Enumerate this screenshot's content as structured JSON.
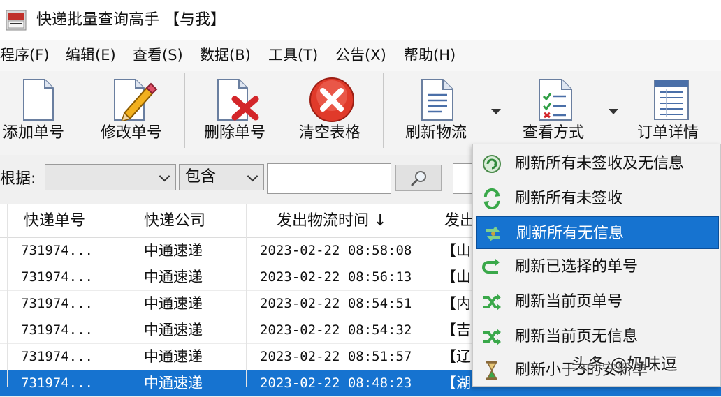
{
  "window": {
    "title": "快递批量查询高手  【与我】"
  },
  "menu": [
    "程序(F)",
    "编辑(E)",
    "查看(S)",
    "数据(B)",
    "工具(T)",
    "公告(X)",
    "帮助(H)"
  ],
  "toolbar": {
    "add": "添加单号",
    "edit": "修改单号",
    "delete": "删除单号",
    "clear": "清空表格",
    "refresh": "刷新物流",
    "view": "查看方式",
    "detail": "订单详情"
  },
  "filter": {
    "label": "根据:",
    "field_value": "",
    "op_value": "包含",
    "text_value": ""
  },
  "table": {
    "headers": [
      "快递单号",
      "快递公司",
      "发出物流时间 ↓",
      "发出"
    ],
    "rows": [
      {
        "no": "731974...",
        "company": "中通速递",
        "time": "2023-02-22  08:58:08",
        "from": "【山"
      },
      {
        "no": "731974...",
        "company": "中通速递",
        "time": "2023-02-22  08:56:13",
        "from": "【山"
      },
      {
        "no": "731974...",
        "company": "中通速递",
        "time": "2023-02-22  08:54:51",
        "from": "【内"
      },
      {
        "no": "731974...",
        "company": "中通速递",
        "time": "2023-02-22  08:54:32",
        "from": "【吉"
      },
      {
        "no": "731974...",
        "company": "中通速递",
        "time": "2023-02-22  08:51:57",
        "from": "【辽"
      },
      {
        "no": "731974...",
        "company": "中通速递",
        "time": "2023-02-22  08:48:23",
        "from": "【湖"
      }
    ]
  },
  "dropdown": [
    "刷新所有未签收及无信息",
    "刷新所有未签收",
    "刷新所有无信息",
    "刷新已选择的单号",
    "刷新当前页单号",
    "刷新当前页无信息",
    "刷新小于3的安新单"
  ],
  "watermark": "头条 @奶味逗",
  "colors": {
    "selection": "#1673d0",
    "clear_red": "#e03a2a",
    "refresh_green": "#3aa84a"
  }
}
